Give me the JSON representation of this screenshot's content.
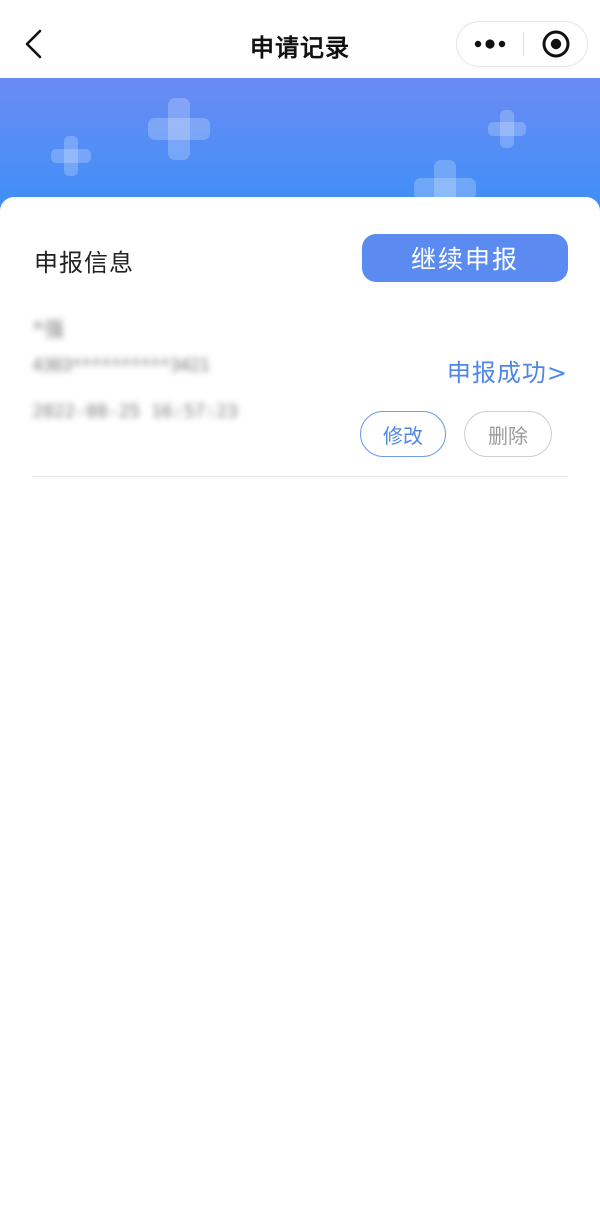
{
  "navbar": {
    "title": "申请记录",
    "back_icon": "chevron-left-icon",
    "more_icon": "more-dots-icon",
    "close_icon": "target-circle-icon"
  },
  "banner": {
    "colors": [
      "#6a8bf3",
      "#3b90f7"
    ],
    "decoration": "plus-cross-icons"
  },
  "section": {
    "title": "申报信息",
    "continue_button": "继续申报"
  },
  "records": [
    {
      "name": "*强",
      "id_number": "4303**********3421",
      "submitted_at": "2022-08-25 16:57:23",
      "status": "申报成功>",
      "edit_label": "修改",
      "delete_label": "删除"
    }
  ],
  "colors": {
    "accent": "#5b8bf0",
    "link": "#4e86ea",
    "muted": "#9a9a9a"
  }
}
